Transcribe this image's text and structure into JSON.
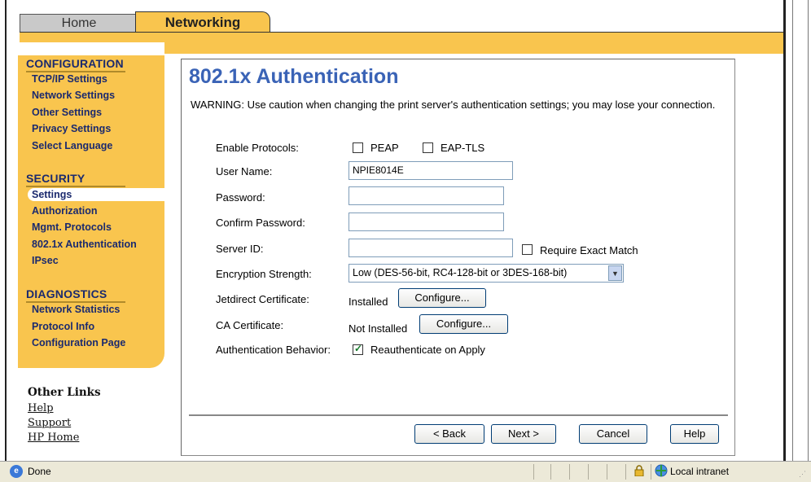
{
  "tabs": {
    "home": "Home",
    "networking": "Networking"
  },
  "sidebar": {
    "configuration": {
      "heading": "CONFIGURATION",
      "items": [
        "TCP/IP Settings",
        "Network Settings",
        "Other Settings",
        "Privacy Settings",
        "Select Language"
      ]
    },
    "security": {
      "heading": "SECURITY",
      "selected": "Settings",
      "items": [
        "Authorization",
        "Mgmt. Protocols",
        "802.1x Authentication",
        "IPsec"
      ]
    },
    "diagnostics": {
      "heading": "DIAGNOSTICS",
      "items": [
        "Network Statistics",
        "Protocol Info",
        "Configuration Page"
      ]
    },
    "other_links": {
      "heading": "Other Links",
      "links": [
        "Help",
        "Support",
        "HP Home"
      ]
    }
  },
  "main": {
    "title": "802.1x Authentication",
    "warning": "WARNING: Use caution when changing the print server's authentication settings; you may lose your connection.",
    "form": {
      "enable_protocols_label": "Enable Protocols:",
      "peap_label": "PEAP",
      "peap_checked": false,
      "eaptls_label": "EAP-TLS",
      "eaptls_checked": false,
      "username_label": "User Name:",
      "username_value": "NPIE8014E",
      "password_label": "Password:",
      "password_value": "",
      "confirm_password_label": "Confirm Password:",
      "confirm_password_value": "",
      "server_id_label": "Server ID:",
      "server_id_value": "",
      "require_exact_label": "Require Exact Match",
      "require_exact_checked": false,
      "encryption_label": "Encryption Strength:",
      "encryption_value": "Low (DES-56-bit, RC4-128-bit or 3DES-168-bit)",
      "jetdirect_cert_label": "Jetdirect Certificate:",
      "jetdirect_cert_status": "Installed",
      "ca_cert_label": "CA Certificate:",
      "ca_cert_status": "Not Installed",
      "configure_label": "Configure...",
      "auth_behavior_label": "Authentication Behavior:",
      "reauth_label": "Reauthenticate on Apply",
      "reauth_checked": true
    },
    "buttons": {
      "back": "< Back",
      "next": "Next >",
      "cancel": "Cancel",
      "help": "Help"
    }
  },
  "statusbar": {
    "status": "Done",
    "zone": "Local intranet"
  },
  "colors": {
    "accent_yellow": "#f9c54e",
    "title_blue": "#3a63b6",
    "nav_blue": "#1b2a6e"
  },
  "icons": [
    "ie-page-icon",
    "lock-icon",
    "globe-intranet-icon"
  ]
}
